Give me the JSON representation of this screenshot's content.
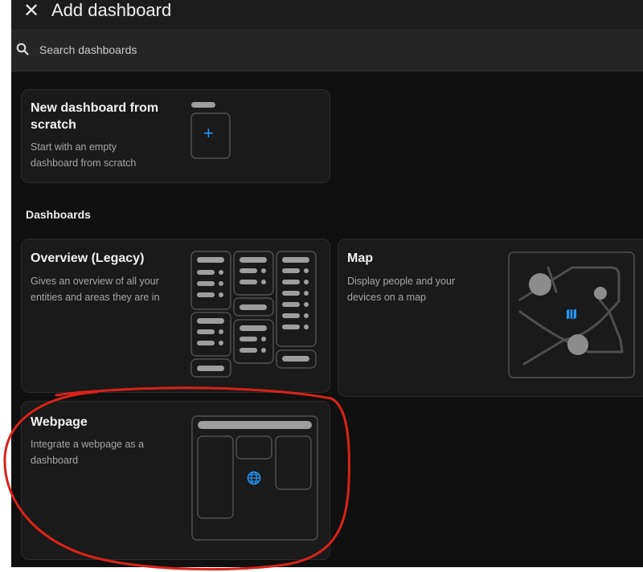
{
  "header": {
    "close_glyph": "✕",
    "title": "Add dashboard"
  },
  "search": {
    "placeholder": "Search dashboards",
    "icon": "search-icon"
  },
  "cards": {
    "scratch": {
      "title": "New dashboard from scratch",
      "desc": "Start with an empty dashboard from scratch",
      "plus": "+"
    },
    "overview": {
      "title": "Overview (Legacy)",
      "desc": "Gives an overview of all your entities and areas they are in"
    },
    "map": {
      "title": "Map",
      "desc": "Display people and your devices on a map"
    },
    "webpage": {
      "title": "Webpage",
      "desc": "Integrate a webpage as a dashboard"
    }
  },
  "section": {
    "dashboards": "Dashboards"
  },
  "colors": {
    "accent": "#2196f3",
    "annotation": "#d8231b",
    "background": "#101010"
  }
}
